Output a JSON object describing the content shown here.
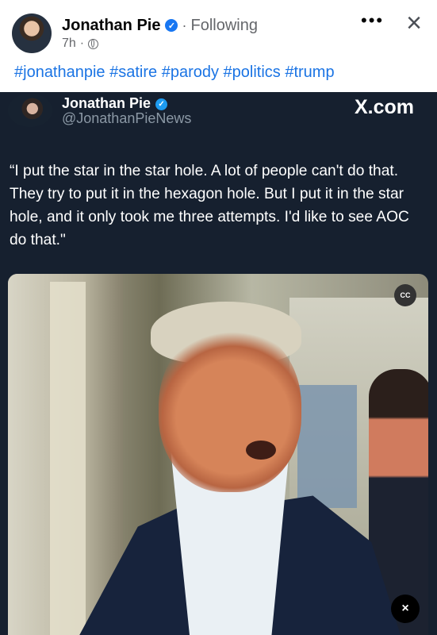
{
  "post": {
    "author": "Jonathan Pie",
    "follow_status": "Following",
    "time": "7h",
    "hashtags": "#jonathanpie #satire #parody #politics #trump"
  },
  "icons": {
    "verified": "verified-badge-icon",
    "privacy": "globe-icon",
    "more": "more-options-icon",
    "close": "close-icon",
    "captions": "closed-captions-icon",
    "mute": "volume-muted-icon"
  },
  "tweet": {
    "name": "Jonathan Pie",
    "handle": "@JonathanPieNews",
    "source": "X.com",
    "text": "“I put the star in the star hole. A lot of people can't do that. They try to put it in the hexagon hole. But I put it in the star hole, and it only took me three attempts. I'd like to see AOC do that.\""
  },
  "video": {
    "captions_label": "CC",
    "mute_label": "×"
  },
  "colors": {
    "facebook_blue": "#1877f2",
    "hashtag_blue": "#1b74e4",
    "tweet_background": "#16202f",
    "tweet_text": "#ffffff",
    "secondary_text": "#65676b"
  }
}
